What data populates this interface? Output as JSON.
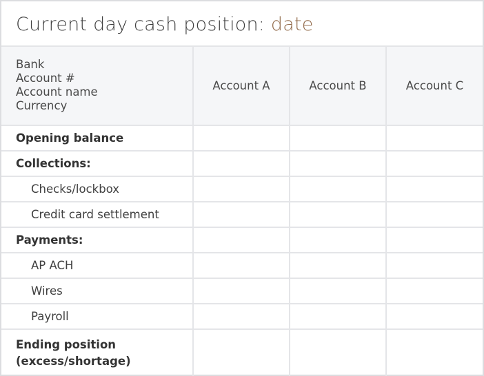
{
  "title": {
    "prefix": "Current day cash position: ",
    "date": "date"
  },
  "header": {
    "label_lines": [
      "Bank",
      "Account #",
      "Account name",
      "Currency"
    ],
    "accounts": [
      "Account A",
      "Account B",
      "Account C"
    ]
  },
  "rows": [
    {
      "label": "Opening balance",
      "bold": true,
      "indent": false
    },
    {
      "label": "Collections:",
      "bold": true,
      "indent": false
    },
    {
      "label": "Checks/lockbox",
      "bold": false,
      "indent": true
    },
    {
      "label": "Credit card settlement",
      "bold": false,
      "indent": true
    },
    {
      "label": "Payments:",
      "bold": true,
      "indent": false
    },
    {
      "label": "AP ACH",
      "bold": false,
      "indent": true
    },
    {
      "label": "Wires",
      "bold": false,
      "indent": true
    },
    {
      "label": "Payroll",
      "bold": false,
      "indent": true
    }
  ],
  "ending_row": {
    "label_lines": [
      "Ending position",
      "(excess/shortage)"
    ]
  },
  "colors": {
    "date_accent": "#936c4c",
    "header_bg": "#f5f6f8",
    "grid_line": "#e4e5e8"
  }
}
